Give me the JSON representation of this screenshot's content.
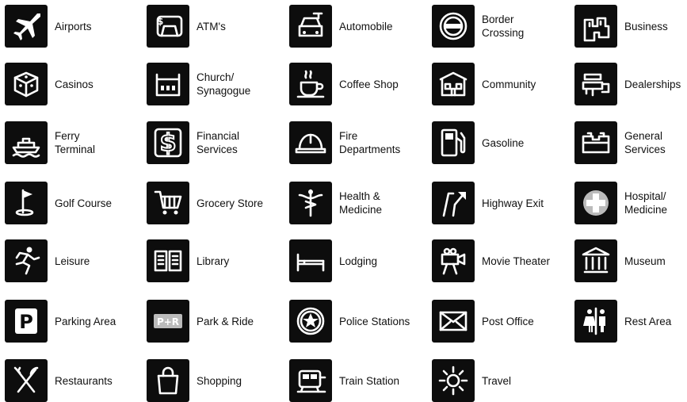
{
  "legend": {
    "items": [
      {
        "label": "Airports",
        "icon": "airplane-icon"
      },
      {
        "label": "ATM's",
        "icon": "atm-icon"
      },
      {
        "label": "Automobile",
        "icon": "automobile-icon"
      },
      {
        "label": "Border\nCrossing",
        "icon": "border-crossing-icon"
      },
      {
        "label": "Business",
        "icon": "business-icon"
      },
      {
        "label": "Casinos",
        "icon": "dice-icon"
      },
      {
        "label": "Church/\nSynagogue",
        "icon": "church-icon"
      },
      {
        "label": "Coffee Shop",
        "icon": "coffee-cup-icon"
      },
      {
        "label": "Community",
        "icon": "community-building-icon"
      },
      {
        "label": "Dealerships",
        "icon": "dealership-icon"
      },
      {
        "label": "Ferry\nTerminal",
        "icon": "ferry-icon"
      },
      {
        "label": "Financial\nServices",
        "icon": "dollar-sign-icon"
      },
      {
        "label": "Fire\nDepartments",
        "icon": "fire-helmet-icon"
      },
      {
        "label": "Gasoline",
        "icon": "fuel-pump-icon"
      },
      {
        "label": "General\nServices",
        "icon": "general-services-icon"
      },
      {
        "label": "Golf Course",
        "icon": "golf-flag-icon"
      },
      {
        "label": "Grocery Store",
        "icon": "shopping-cart-icon"
      },
      {
        "label": "Health &\nMedicine",
        "icon": "caduceus-icon"
      },
      {
        "label": "Highway Exit",
        "icon": "highway-exit-icon"
      },
      {
        "label": "Hospital/\nMedicine",
        "icon": "hospital-cross-icon"
      },
      {
        "label": "Leisure",
        "icon": "runner-icon"
      },
      {
        "label": "Library",
        "icon": "open-book-icon"
      },
      {
        "label": "Lodging",
        "icon": "bed-icon"
      },
      {
        "label": "Movie Theater",
        "icon": "movie-camera-icon"
      },
      {
        "label": "Museum",
        "icon": "museum-icon"
      },
      {
        "label": "Parking Area",
        "icon": "parking-icon"
      },
      {
        "label": "Park & Ride",
        "icon": "park-and-ride-icon"
      },
      {
        "label": "Police Stations",
        "icon": "police-badge-icon"
      },
      {
        "label": "Post Office",
        "icon": "envelope-icon"
      },
      {
        "label": "Rest Area",
        "icon": "restroom-icon"
      },
      {
        "label": "Restaurants",
        "icon": "fork-knife-icon"
      },
      {
        "label": "Shopping",
        "icon": "shopping-bag-icon"
      },
      {
        "label": "Train Station",
        "icon": "train-icon"
      },
      {
        "label": "Travel",
        "icon": "sun-icon"
      }
    ],
    "parking_letter": "P",
    "park_ride_text": "P+R"
  }
}
